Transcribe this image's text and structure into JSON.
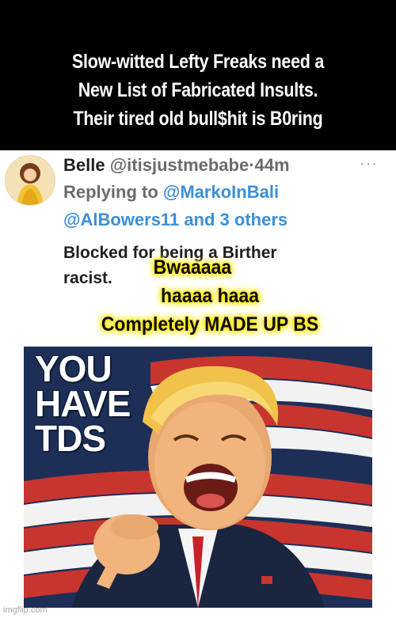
{
  "caption": {
    "line1": "Slow-witted Lefty Freaks need a",
    "line2": "New List of Fabricated Insults.",
    "line3": "Their tired old bull$hit is B0ring"
  },
  "tweet": {
    "display_name": "Belle",
    "handle": "@itisjustmebabe",
    "separator": "·",
    "time": "44m",
    "more_icon": "more-horizontal-icon",
    "replying_prefix": "Replying to",
    "reply_handle_1": "@MarkoInBali",
    "reply_handle_2": "@AlBowers11",
    "reply_others": "and 3 others",
    "body_line1": "Blocked for being a Birther",
    "body_line2": "racist."
  },
  "overlay": {
    "line1": "Bwaaaaa",
    "line2": "haaaa haaa",
    "line3": "Completely MADE UP BS",
    "highlight_color": "#ffe500"
  },
  "poster": {
    "line1": "YOU",
    "line2": "HAVE",
    "line3": "TDS"
  },
  "watermark": "imgflip.com",
  "colors": {
    "link": "#3b8fd6",
    "caption_bg": "#000000",
    "flag_red": "#c8352f",
    "flag_blue": "#1d2f57"
  }
}
